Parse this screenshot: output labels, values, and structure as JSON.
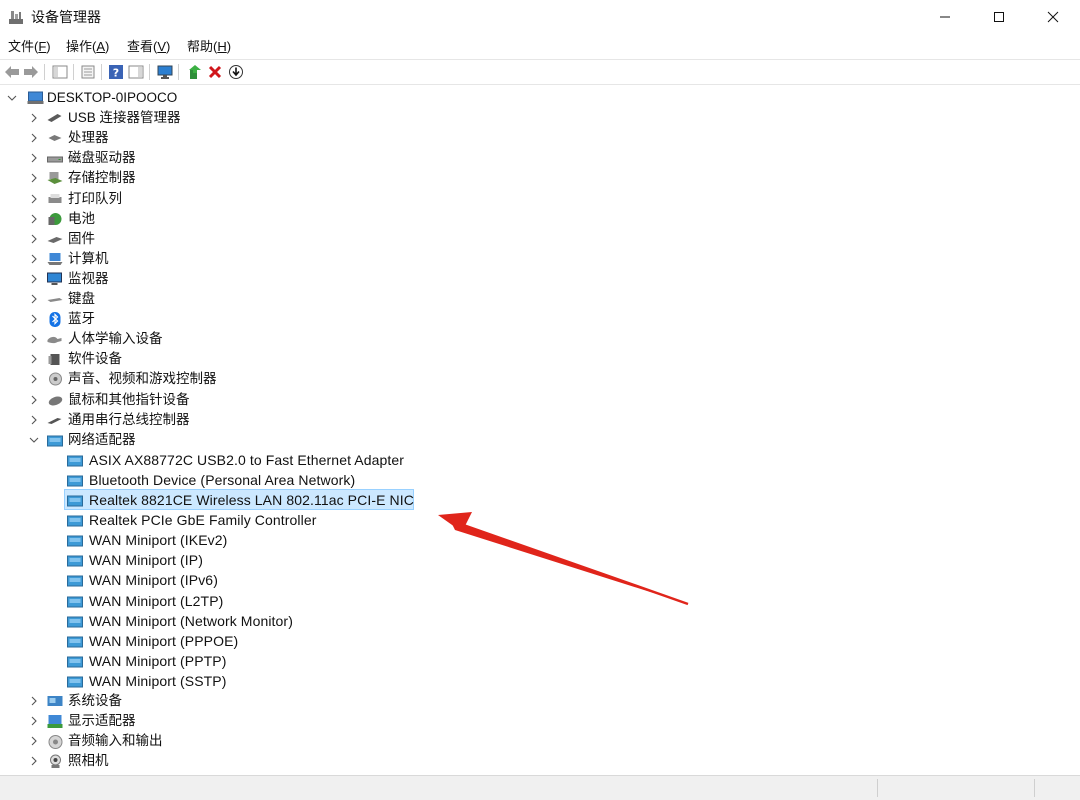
{
  "window": {
    "title": "设备管理器",
    "controls": {
      "minimize": "—",
      "maximize": "☐",
      "close": "✕"
    }
  },
  "menu": [
    {
      "label": "文件(",
      "key": "F",
      "tail": ")"
    },
    {
      "label": "操作(",
      "key": "A",
      "tail": ")"
    },
    {
      "label": "查看(",
      "key": "V",
      "tail": ")"
    },
    {
      "label": "帮助(",
      "key": "H",
      "tail": ")"
    }
  ],
  "toolbar": {
    "icons": [
      "back-arrow-icon",
      "forward-arrow-icon",
      "show-hide-console-tree-icon",
      "properties-icon",
      "help-icon",
      "action-pane-icon",
      "monitor-icon",
      "update-driver-icon",
      "uninstall-icon",
      "scan-hardware-icon"
    ]
  },
  "tree": {
    "root": "DESKTOP-0IPOOCO",
    "categories": [
      "USB 连接器管理器",
      "处理器",
      "磁盘驱动器",
      "存储控制器",
      "打印队列",
      "电池",
      "固件",
      "计算机",
      "监视器",
      "键盘",
      "蓝牙",
      "人体学输入设备",
      "软件设备",
      "声音、视频和游戏控制器",
      "鼠标和其他指针设备",
      "通用串行总线控制器",
      "网络适配器"
    ],
    "network_adapters": [
      "ASIX AX88772C USB2.0 to Fast Ethernet Adapter",
      "Bluetooth Device (Personal Area Network)",
      "Realtek 8821CE Wireless LAN 802.11ac PCI-E NIC",
      "Realtek PCIe GbE Family Controller",
      "WAN Miniport (IKEv2)",
      "WAN Miniport (IP)",
      "WAN Miniport (IPv6)",
      "WAN Miniport (L2TP)",
      "WAN Miniport (Network Monitor)",
      "WAN Miniport (PPPOE)",
      "WAN Miniport (PPTP)",
      "WAN Miniport (SSTP)"
    ],
    "after": [
      "系统设备",
      "显示适配器",
      "音频输入和输出",
      "照相机"
    ],
    "selected": "Realtek 8821CE Wireless LAN 802.11ac PCI-E NIC"
  },
  "colors": {
    "selection_bg": "#cce8ff",
    "selection_border": "#99d1ff",
    "arrow": "#e0251b"
  }
}
